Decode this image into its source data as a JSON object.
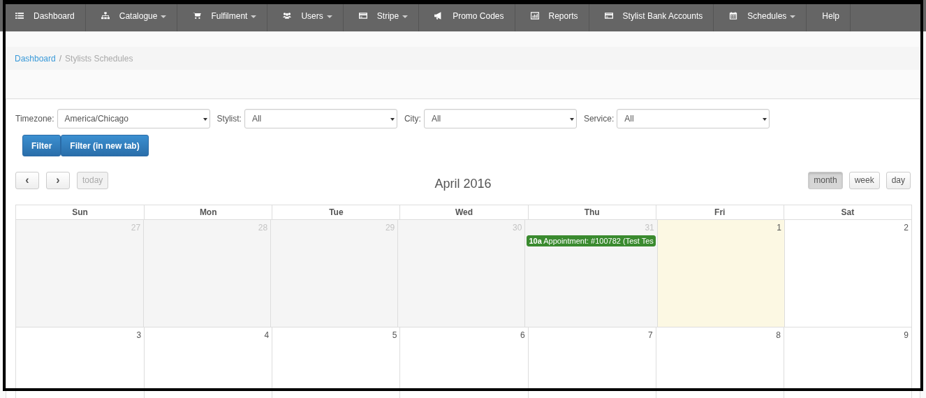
{
  "navbar": {
    "items": [
      {
        "kind": "list",
        "label": "Dashboard",
        "dropdown": false
      },
      {
        "kind": "sitemap",
        "label": "Catalogue",
        "dropdown": true
      },
      {
        "kind": "cart",
        "label": "Fulfilment",
        "dropdown": true
      },
      {
        "kind": "users",
        "label": "Users",
        "dropdown": true
      },
      {
        "kind": "card",
        "label": "Stripe",
        "dropdown": true
      },
      {
        "kind": "bullhorn",
        "label": "Promo Codes",
        "dropdown": false
      },
      {
        "kind": "chart",
        "label": "Reports",
        "dropdown": false
      },
      {
        "kind": "card",
        "label": "Stylist Bank Accounts",
        "dropdown": false
      },
      {
        "kind": "calendar",
        "label": "Schedules",
        "dropdown": true
      },
      {
        "kind": "plain",
        "label": "Help",
        "dropdown": false
      }
    ]
  },
  "breadcrumb": {
    "separator": "/",
    "items": [
      {
        "label": "Dashboard",
        "link": true
      },
      {
        "label": "Stylists Schedules",
        "link": false
      }
    ]
  },
  "filters": [
    {
      "label": "Timezone:",
      "value": "America/Chicago"
    },
    {
      "label": "Stylist:",
      "value": "All"
    },
    {
      "label": "City:",
      "value": "All"
    },
    {
      "label": "Service:",
      "value": "All"
    }
  ],
  "filter_buttons": [
    "Filter",
    "Filter (in new tab)"
  ],
  "calendar": {
    "title": "April 2016",
    "nav": [
      {
        "kind": "prev",
        "label": "‹",
        "disabled": false
      },
      {
        "kind": "next",
        "label": "›",
        "disabled": false
      },
      {
        "kind": "today",
        "label": "today",
        "disabled": true
      }
    ],
    "views": [
      {
        "label": "month",
        "selected": true
      },
      {
        "label": "week",
        "selected": false
      },
      {
        "label": "day",
        "selected": false
      }
    ],
    "weekdays": [
      "Sun",
      "Mon",
      "Tue",
      "Wed",
      "Thu",
      "Fri",
      "Sat"
    ],
    "weeks": [
      [
        {
          "day": "27",
          "other_month": true,
          "today": false
        },
        {
          "day": "28",
          "other_month": true,
          "today": false
        },
        {
          "day": "29",
          "other_month": true,
          "today": false
        },
        {
          "day": "30",
          "other_month": true,
          "today": false
        },
        {
          "day": "31",
          "other_month": true,
          "today": false,
          "events": [
            {
              "time": "10a",
              "title": "Appointment: #100782 (Test Tes",
              "color": "#3a8a2f"
            }
          ]
        },
        {
          "day": "1",
          "other_month": false,
          "today": true
        },
        {
          "day": "2",
          "other_month": false,
          "today": false
        }
      ],
      [
        {
          "day": "3",
          "other_month": false,
          "today": false
        },
        {
          "day": "4",
          "other_month": false,
          "today": false
        },
        {
          "day": "5",
          "other_month": false,
          "today": false
        },
        {
          "day": "6",
          "other_month": false,
          "today": false
        },
        {
          "day": "7",
          "other_month": false,
          "today": false
        },
        {
          "day": "8",
          "other_month": false,
          "today": false
        },
        {
          "day": "9",
          "other_month": false,
          "today": false
        }
      ]
    ]
  }
}
